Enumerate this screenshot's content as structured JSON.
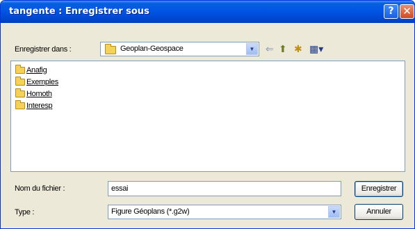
{
  "window": {
    "title": "tangente : Enregistrer sous",
    "help_label": "?",
    "close_label": "✕"
  },
  "location": {
    "label": "Enregistrer dans :",
    "value": "Geoplan-Geospace"
  },
  "toolbar": {
    "back_glyph": "⇐",
    "up_glyph": "⬆",
    "new_folder_glyph": "✱",
    "views_glyph": "▦▾"
  },
  "files": [
    {
      "name": "Anafig"
    },
    {
      "name": "Exemples"
    },
    {
      "name": "Homoth"
    },
    {
      "name": "Interesp"
    }
  ],
  "filename": {
    "label": "Nom du fichier :",
    "value": "essai"
  },
  "filetype": {
    "label": "Type :",
    "value": "Figure Géoplans (*.g2w)"
  },
  "buttons": {
    "save": "Enregistrer",
    "cancel": "Annuler"
  },
  "colors": {
    "titlebar": "#0055e5",
    "dialog_bg": "#ece9d8",
    "folder": "#f4d25a"
  }
}
